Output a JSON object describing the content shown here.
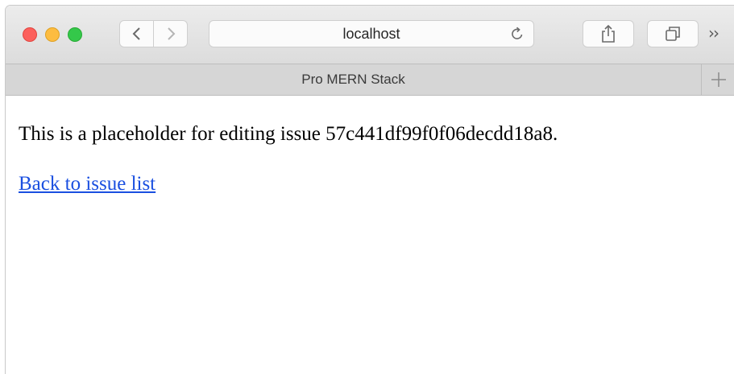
{
  "browser": {
    "address": "localhost",
    "tab_title": "Pro MERN Stack",
    "more_label": "››",
    "new_tab_label": "+",
    "icons": {
      "back": "chevron-left-icon",
      "forward": "chevron-right-icon",
      "reload": "reload-icon",
      "share": "share-icon",
      "tabs": "tab-overview-icon",
      "new_tab": "plus-icon"
    },
    "colors": {
      "close": "#fc605c",
      "minimize": "#fdbc40",
      "zoom": "#34c84a"
    }
  },
  "page": {
    "message": "This is a placeholder for editing issue 57c441df99f0f06decdd18a8.",
    "back_link": "Back to issue list",
    "link_color": "#1a4fe0"
  }
}
